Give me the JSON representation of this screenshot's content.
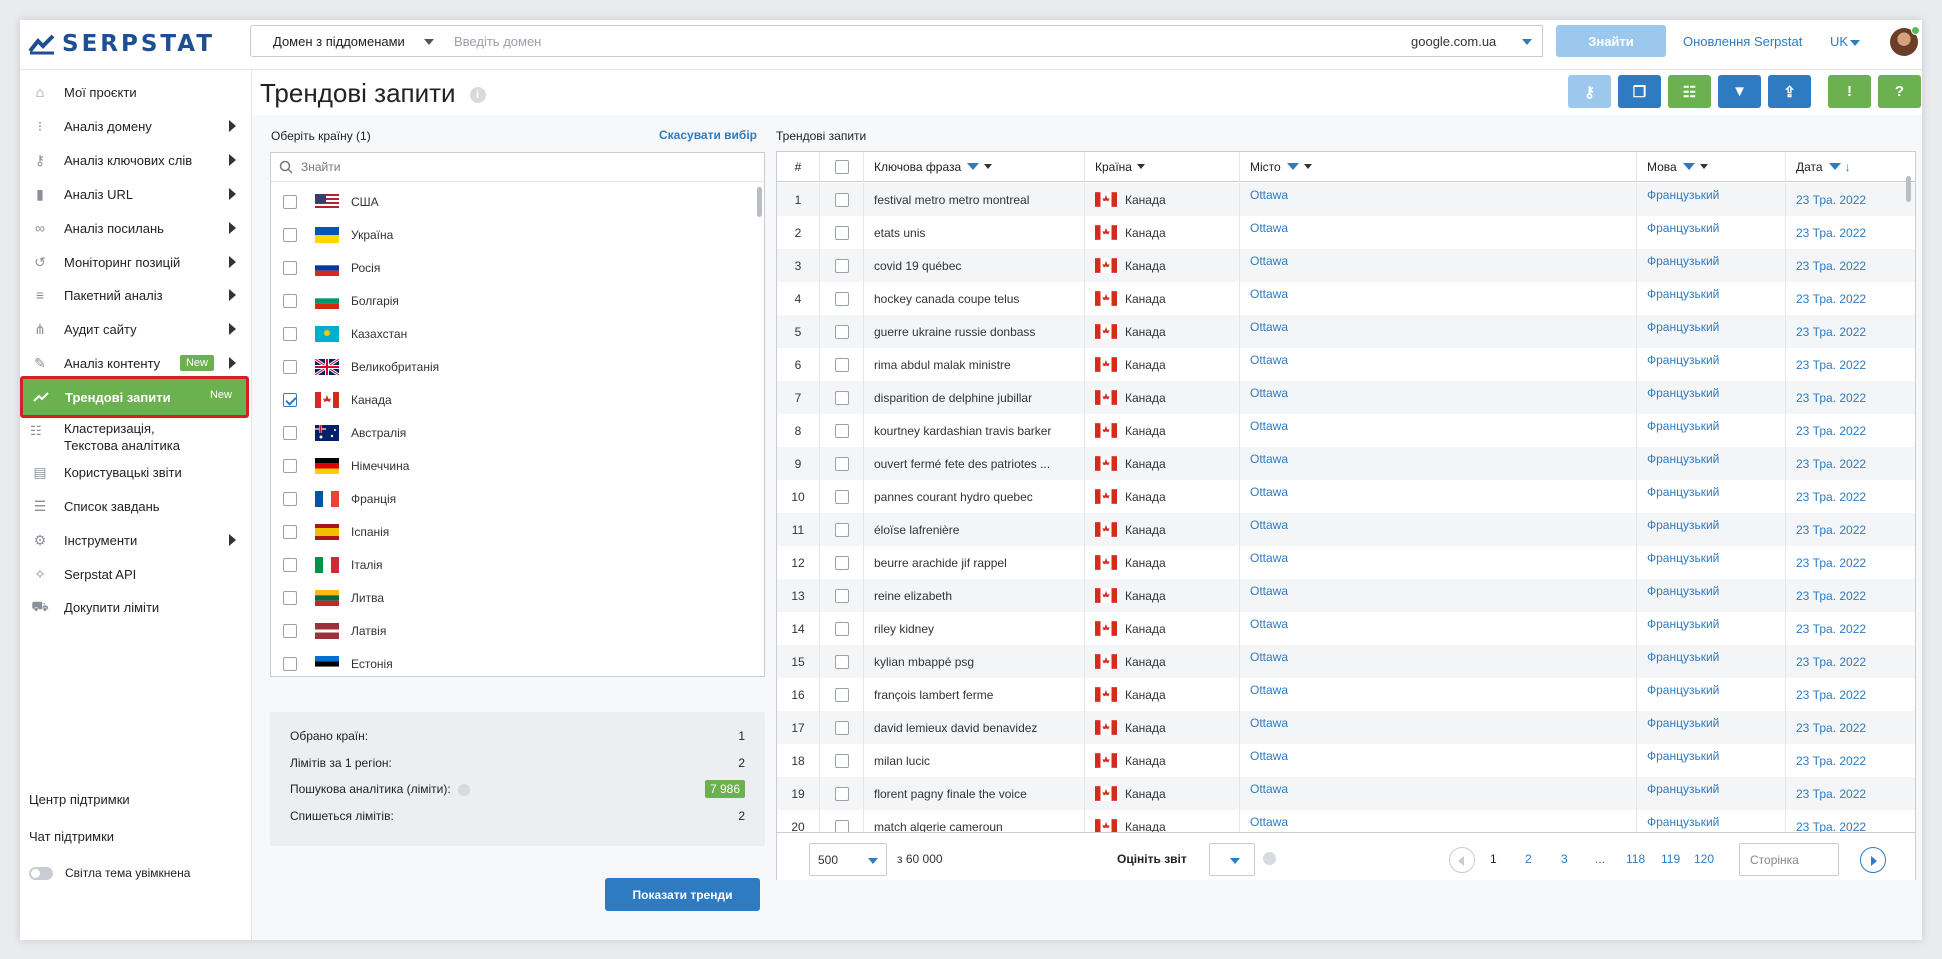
{
  "app": {
    "logo": "SERPSTAT"
  },
  "search": {
    "mode": "Домен з піддоменами",
    "placeholder": "Введіть домен",
    "engine": "google.com.ua",
    "find_label": "Знайти",
    "updates_label": "Оновлення Serpstat",
    "lang": "UK"
  },
  "sidebar": {
    "items": [
      {
        "label": "Мої проєкти",
        "icon": "home-icon"
      },
      {
        "label": "Аналіз домену",
        "icon": "domain-icon"
      },
      {
        "label": "Аналіз ключових слів",
        "icon": "key-icon"
      },
      {
        "label": "Аналіз URL",
        "icon": "bars-icon"
      },
      {
        "label": "Аналіз посилань",
        "icon": "link-icon"
      },
      {
        "label": "Моніторинг позицій",
        "icon": "history-icon"
      },
      {
        "label": "Пакетний аналіз",
        "icon": "database-icon"
      },
      {
        "label": "Аудит сайту",
        "icon": "sitemap-icon"
      },
      {
        "label": "Аналіз контенту",
        "icon": "pencil-icon",
        "badge": "New"
      }
    ],
    "active": {
      "label": "Трендові запити",
      "badge": "New"
    },
    "clustering": {
      "line1": "Кластеризація,",
      "line2": "Текстова аналітика"
    },
    "more": [
      {
        "label": "Користувацькі звіти"
      },
      {
        "label": "Список завдань"
      },
      {
        "label": "Інструменти"
      },
      {
        "label": "Serpstat API"
      },
      {
        "label": "Докупити ліміти"
      }
    ],
    "support_center": "Центр підтримки",
    "support_chat": "Чат підтримки",
    "theme_label": "Світла тема увімкнена"
  },
  "page": {
    "title": "Трендові запити"
  },
  "countries": {
    "label": "Оберіть країну (1)",
    "cancel": "Скасувати вибір",
    "search_placeholder": "Знайти",
    "list": [
      {
        "name": "США",
        "checked": false,
        "flag": "us"
      },
      {
        "name": "Україна",
        "checked": false,
        "flag": "ua"
      },
      {
        "name": "Росія",
        "checked": false,
        "flag": "ru"
      },
      {
        "name": "Болгарія",
        "checked": false,
        "flag": "bg"
      },
      {
        "name": "Казахстан",
        "checked": false,
        "flag": "kz"
      },
      {
        "name": "Великобританія",
        "checked": false,
        "flag": "gb"
      },
      {
        "name": "Канада",
        "checked": true,
        "flag": "ca"
      },
      {
        "name": "Австралія",
        "checked": false,
        "flag": "au"
      },
      {
        "name": "Німеччина",
        "checked": false,
        "flag": "de"
      },
      {
        "name": "Франція",
        "checked": false,
        "flag": "fr"
      },
      {
        "name": "Іспанія",
        "checked": false,
        "flag": "es"
      },
      {
        "name": "Італія",
        "checked": false,
        "flag": "it"
      },
      {
        "name": "Литва",
        "checked": false,
        "flag": "lt"
      },
      {
        "name": "Латвія",
        "checked": false,
        "flag": "lv"
      },
      {
        "name": "Естонія",
        "checked": false,
        "flag": "ee"
      }
    ]
  },
  "summary": {
    "rows": [
      {
        "label": "Обрано країн:",
        "value": "1"
      },
      {
        "label": "Лімітів за 1 регіон:",
        "value": "2"
      },
      {
        "label": "Пошукова аналітика (ліміти):",
        "value": "7 986"
      },
      {
        "label": "Спишеться лімітів:",
        "value": "2"
      }
    ],
    "show_button": "Показати тренди"
  },
  "table": {
    "label": "Трендові запити",
    "headers": {
      "num": "#",
      "keyword": "Ключова фраза",
      "country": "Країна",
      "city": "Місто",
      "language": "Мова",
      "date": "Дата"
    },
    "rows": [
      {
        "n": "1",
        "keyword": "festival metro metro montreal",
        "country": "Канада",
        "city": "Ottawa",
        "language": "Французький",
        "date": "23 Тра. 2022"
      },
      {
        "n": "2",
        "keyword": "etats unis",
        "country": "Канада",
        "city": "Ottawa",
        "language": "Французький",
        "date": "23 Тра. 2022"
      },
      {
        "n": "3",
        "keyword": "covid 19 québec",
        "country": "Канада",
        "city": "Ottawa",
        "language": "Французький",
        "date": "23 Тра. 2022"
      },
      {
        "n": "4",
        "keyword": "hockey canada coupe telus",
        "country": "Канада",
        "city": "Ottawa",
        "language": "Французький",
        "date": "23 Тра. 2022"
      },
      {
        "n": "5",
        "keyword": "guerre ukraine russie donbass",
        "country": "Канада",
        "city": "Ottawa",
        "language": "Французький",
        "date": "23 Тра. 2022"
      },
      {
        "n": "6",
        "keyword": "rima abdul malak ministre",
        "country": "Канада",
        "city": "Ottawa",
        "language": "Французький",
        "date": "23 Тра. 2022"
      },
      {
        "n": "7",
        "keyword": "disparition de delphine jubillar",
        "country": "Канада",
        "city": "Ottawa",
        "language": "Французький",
        "date": "23 Тра. 2022"
      },
      {
        "n": "8",
        "keyword": "kourtney kardashian travis barker",
        "country": "Канада",
        "city": "Ottawa",
        "language": "Французький",
        "date": "23 Тра. 2022"
      },
      {
        "n": "9",
        "keyword": "ouvert fermé fete des patriotes ...",
        "country": "Канада",
        "city": "Ottawa",
        "language": "Французький",
        "date": "23 Тра. 2022"
      },
      {
        "n": "10",
        "keyword": "pannes courant hydro quebec",
        "country": "Канада",
        "city": "Ottawa",
        "language": "Французький",
        "date": "23 Тра. 2022"
      },
      {
        "n": "11",
        "keyword": "éloïse lafrenière",
        "country": "Канада",
        "city": "Ottawa",
        "language": "Французький",
        "date": "23 Тра. 2022"
      },
      {
        "n": "12",
        "keyword": "beurre arachide jif rappel",
        "country": "Канада",
        "city": "Ottawa",
        "language": "Французький",
        "date": "23 Тра. 2022"
      },
      {
        "n": "13",
        "keyword": "reine elizabeth",
        "country": "Канада",
        "city": "Ottawa",
        "language": "Французький",
        "date": "23 Тра. 2022"
      },
      {
        "n": "14",
        "keyword": "riley kidney",
        "country": "Канада",
        "city": "Ottawa",
        "language": "Французький",
        "date": "23 Тра. 2022"
      },
      {
        "n": "15",
        "keyword": "kylian mbappé psg",
        "country": "Канада",
        "city": "Ottawa",
        "language": "Французький",
        "date": "23 Тра. 2022"
      },
      {
        "n": "16",
        "keyword": "françois lambert ferme",
        "country": "Канада",
        "city": "Ottawa",
        "language": "Французький",
        "date": "23 Тра. 2022"
      },
      {
        "n": "17",
        "keyword": "david lemieux david benavidez",
        "country": "Канада",
        "city": "Ottawa",
        "language": "Французький",
        "date": "23 Тра. 2022"
      },
      {
        "n": "18",
        "keyword": "milan lucic",
        "country": "Канада",
        "city": "Ottawa",
        "language": "Французький",
        "date": "23 Тра. 2022"
      },
      {
        "n": "19",
        "keyword": "florent pagny finale the voice",
        "country": "Канада",
        "city": "Ottawa",
        "language": "Французький",
        "date": "23 Тра. 2022"
      },
      {
        "n": "20",
        "keyword": "match algerie cameroun",
        "country": "Канада",
        "city": "Ottawa",
        "language": "Французький",
        "date": "23 Тра. 2022"
      }
    ],
    "footer": {
      "per_page": "500",
      "total": "з 60 000",
      "rate_label": "Оцініть звіт",
      "pages": [
        "1",
        "2",
        "3",
        "...",
        "118",
        "119",
        "120"
      ],
      "page_placeholder": "Сторінка"
    }
  },
  "colors": {
    "accent": "#2f7bc1",
    "green": "#6bb14f",
    "highlight": "#d32027"
  }
}
